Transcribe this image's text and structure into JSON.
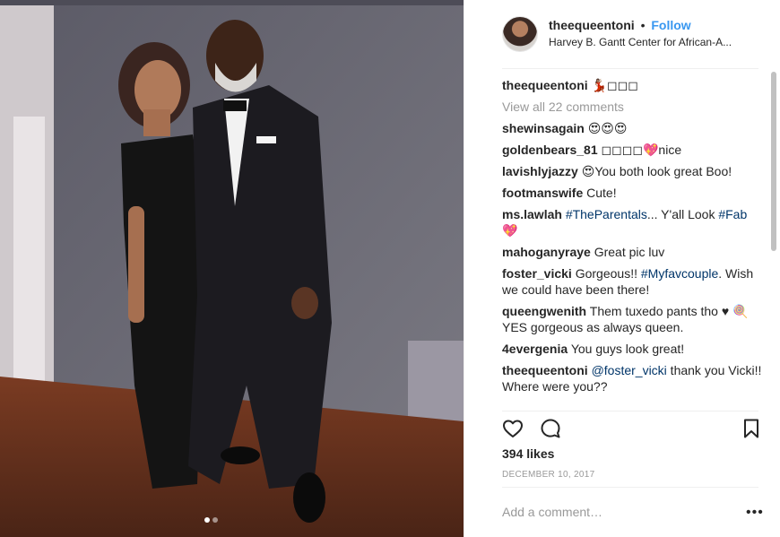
{
  "post": {
    "username": "theequeentoni",
    "separator": "•",
    "follow_label": "Follow",
    "location": "Harvey B. Gantt Center for African-A..."
  },
  "caption": {
    "user": "theequeentoni",
    "text": "💃🏽◻◻◻"
  },
  "view_all_label": "View all 22 comments",
  "comments": [
    {
      "user": "shewinsagain",
      "text": "😍😍😍"
    },
    {
      "user": "goldenbears_81",
      "text": "◻◻◻◻💖nice"
    },
    {
      "user": "lavishlyjazzy",
      "text": "😍You both look great Boo!"
    },
    {
      "user": "footmanswife",
      "text": "Cute!"
    },
    {
      "user": "ms.lawlah",
      "tag": "#TheParentals",
      "text": "... Y'all Look",
      "tag2": "#Fab",
      "text2": " 💖"
    },
    {
      "user": "mahoganyraye",
      "text": "Great pic luv"
    },
    {
      "user": "foster_vicki",
      "text": "Gorgeous!!",
      "tag": "#Myfavcouple",
      "text2": ". Wish we could have been there!"
    },
    {
      "user": "queengwenith",
      "text": "Them tuxedo pants tho ♥ 🍭YES gorgeous as always queen."
    },
    {
      "user": "4evergenia",
      "text": "You guys look great!"
    },
    {
      "user": "theequeentoni",
      "tag": "@foster_vicki",
      "text": " thank you Vicki!! Where were you??"
    }
  ],
  "icons": {
    "like": "heart-icon",
    "comment": "comment-bubble-icon",
    "save": "bookmark-icon",
    "more": "more-options-icon"
  },
  "likes_label": "394 likes",
  "date_label": "DECEMBER 10, 2017",
  "add_comment_placeholder": "Add a comment…",
  "more_label": "•••",
  "carousel": {
    "count": 2,
    "active": 1
  },
  "colors": {
    "link": "#3897f0",
    "hashtag": "#003569",
    "muted": "#999999",
    "text": "#262626"
  }
}
